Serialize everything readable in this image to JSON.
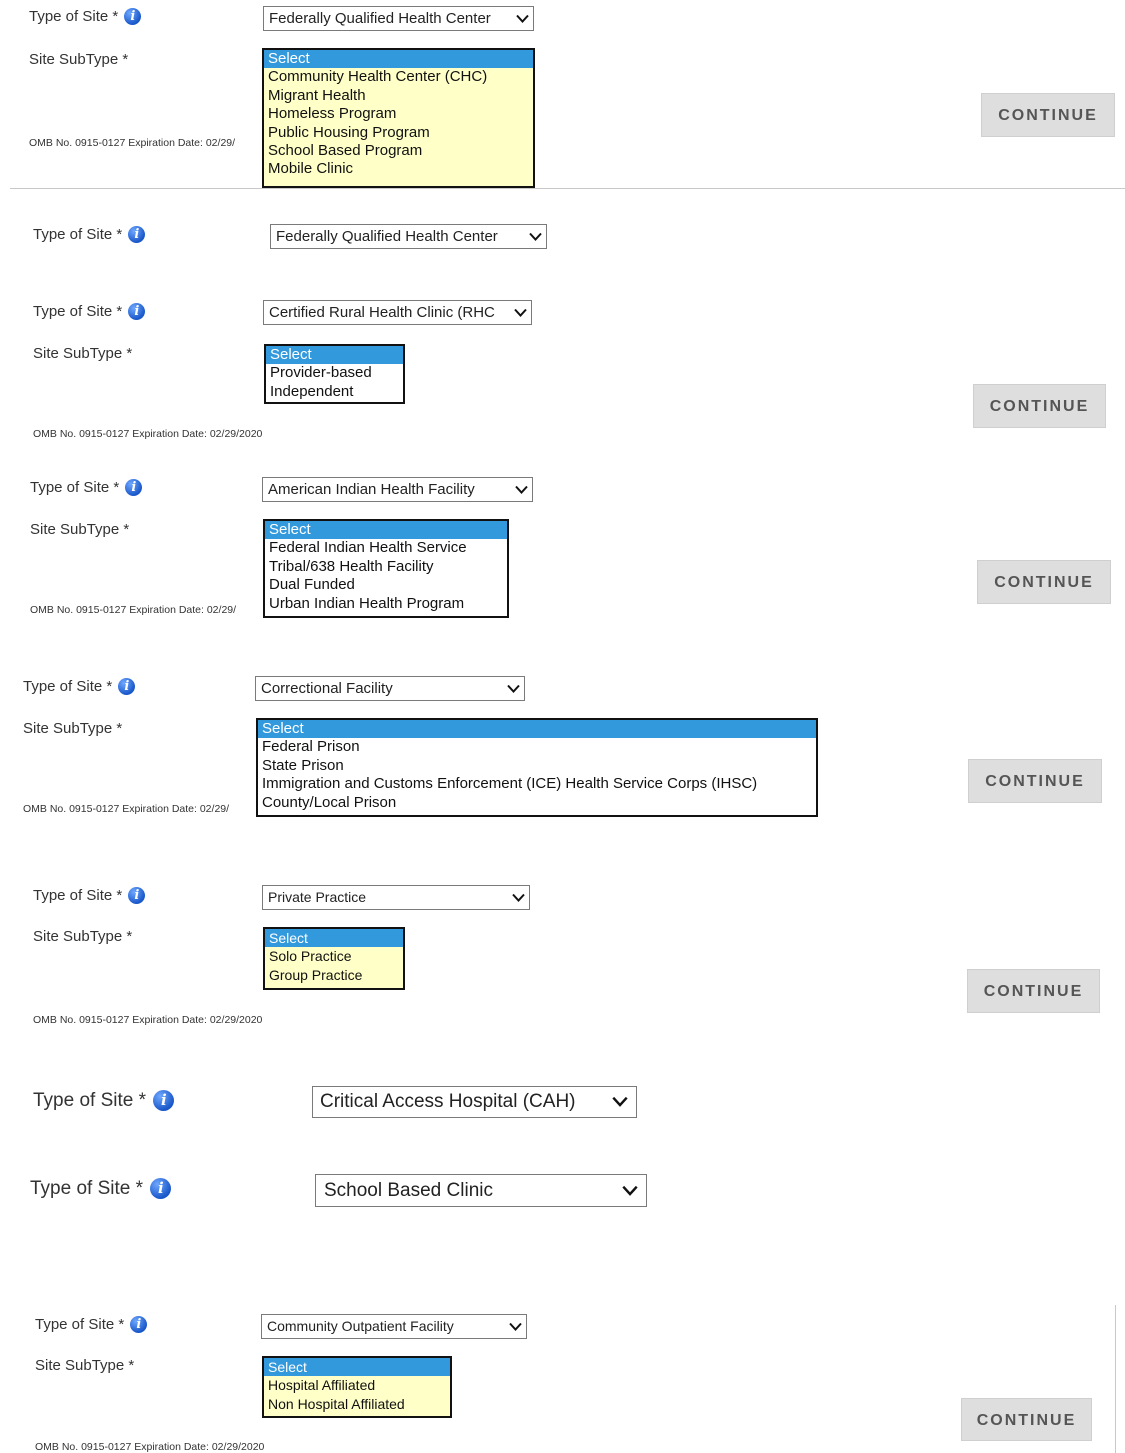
{
  "labels": {
    "type_of_site": "Type of Site *",
    "site_subtype": "Site SubType *",
    "info_glyph": "i"
  },
  "omb_full": "OMB No. 0915-0127 Expiration Date: 02/29/2020",
  "omb_clipped": "OMB No. 0915-0127 Expiration Date: 02/29/",
  "continue_label": "CONTINUE",
  "icons": [
    "info-icon",
    "chevron-down-icon"
  ],
  "colors": {
    "listbox_highlight": "#3399dd",
    "listbox_yellow": "#ffffc8",
    "info_blue": "#1a57c9",
    "button_bg": "#dedede"
  },
  "panels": {
    "fqhc": {
      "type_value": "Federally Qualified Health Center",
      "options": [
        "Select",
        "Community Health Center (CHC)",
        "Migrant Health",
        "Homeless Program",
        "Public Housing Program",
        "School Based Program",
        "Mobile Clinic"
      ]
    },
    "fqhc_collapsed": {
      "type_value": "Federally Qualified Health Center"
    },
    "rhc": {
      "type_value": "Certified Rural Health Clinic (RHC",
      "options": [
        "Select",
        "Provider-based",
        "Independent"
      ]
    },
    "aihf": {
      "type_value": "American Indian Health Facility",
      "options": [
        "Select",
        "Federal Indian Health Service",
        "Tribal/638 Health Facility",
        "Dual Funded",
        "Urban Indian Health Program"
      ]
    },
    "correctional": {
      "type_value": "Correctional Facility",
      "options": [
        "Select",
        "Federal Prison",
        "State Prison",
        "Immigration and Customs Enforcement (ICE) Health Service Corps (IHSC)",
        "County/Local Prison"
      ]
    },
    "private": {
      "type_value": "Private Practice",
      "options": [
        "Select",
        "Solo Practice",
        "Group Practice"
      ]
    },
    "cah": {
      "type_value": "Critical Access Hospital (CAH)"
    },
    "school": {
      "type_value": "School Based Clinic"
    },
    "outpatient": {
      "type_value": "Community Outpatient Facility",
      "options": [
        "Select",
        "Hospital Affiliated",
        "Non Hospital Affiliated"
      ]
    }
  }
}
